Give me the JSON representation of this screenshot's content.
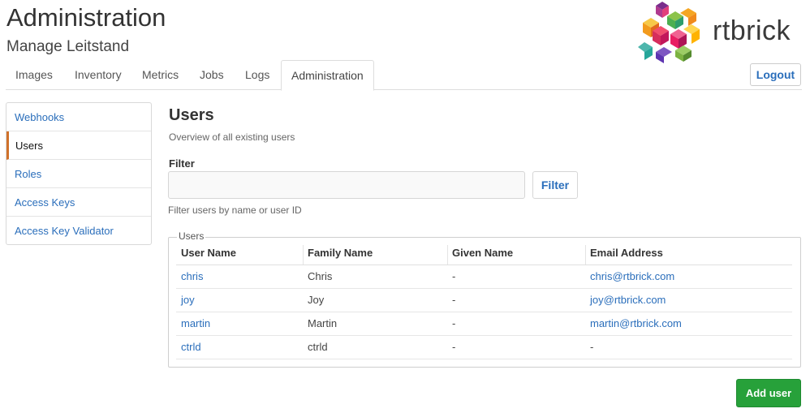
{
  "header": {
    "title": "Administration",
    "subtitle": "Manage Leitstand",
    "logo_text": "rtbrick",
    "logout_label": "Logout"
  },
  "nav": {
    "tabs": [
      {
        "label": "Images",
        "active": false
      },
      {
        "label": "Inventory",
        "active": false
      },
      {
        "label": "Metrics",
        "active": false
      },
      {
        "label": "Jobs",
        "active": false
      },
      {
        "label": "Logs",
        "active": false
      },
      {
        "label": "Administration",
        "active": true
      }
    ]
  },
  "sidebar": {
    "items": [
      {
        "label": "Webhooks",
        "active": false
      },
      {
        "label": "Users",
        "active": true
      },
      {
        "label": "Roles",
        "active": false
      },
      {
        "label": "Access Keys",
        "active": false
      },
      {
        "label": "Access Key Validator",
        "active": false
      }
    ]
  },
  "main": {
    "title": "Users",
    "description": "Overview of all existing users",
    "filter": {
      "label": "Filter",
      "value": "",
      "button_label": "Filter",
      "help": "Filter users by name or user ID"
    },
    "table": {
      "legend": "Users",
      "columns": [
        "User Name",
        "Family Name",
        "Given Name",
        "Email Address"
      ],
      "rows": [
        {
          "user_name": "chris",
          "family_name": "Chris",
          "given_name": "-",
          "email": "chris@rtbrick.com"
        },
        {
          "user_name": "joy",
          "family_name": "Joy",
          "given_name": "-",
          "email": "joy@rtbrick.com"
        },
        {
          "user_name": "martin",
          "family_name": "Martin",
          "given_name": "-",
          "email": "martin@rtbrick.com"
        },
        {
          "user_name": "ctrld",
          "family_name": "ctrld",
          "given_name": "-",
          "email": "-"
        }
      ]
    },
    "add_button_label": "Add user"
  },
  "colors": {
    "link": "#2a6ebb",
    "active_marker": "#d0712b",
    "primary_button": "#27a13a"
  }
}
